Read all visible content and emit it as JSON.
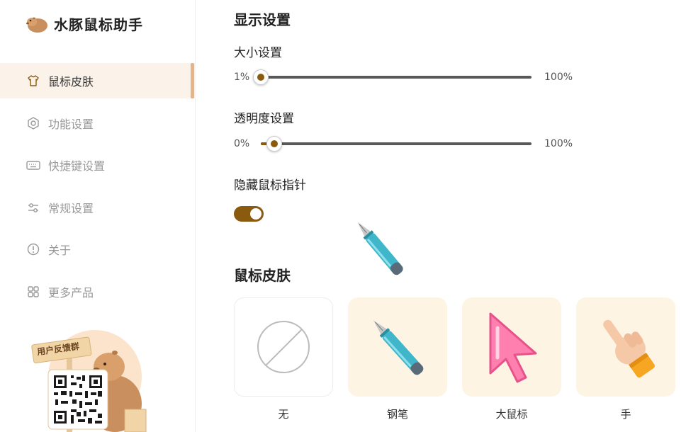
{
  "app": {
    "title": "水豚鼠标助手",
    "accent": "#8a5a0e",
    "active_bg": "#fbf3ea"
  },
  "sidebar": {
    "items": [
      {
        "label": "鼠标皮肤",
        "icon": "shirt-icon",
        "active": true
      },
      {
        "label": "功能设置",
        "icon": "hexagon-settings-icon",
        "active": false
      },
      {
        "label": "快捷键设置",
        "icon": "keyboard-icon",
        "active": false
      },
      {
        "label": "常规设置",
        "icon": "sliders-icon",
        "active": false
      },
      {
        "label": "关于",
        "icon": "info-icon",
        "active": false
      },
      {
        "label": "更多产品",
        "icon": "grid-icon",
        "active": false
      }
    ],
    "promo": {
      "sign_text": "用户反馈群",
      "image": "capybara-qr-code"
    }
  },
  "display": {
    "title": "显示设置",
    "size": {
      "label": "大小设置",
      "min_label": "1%",
      "max_label": "100%",
      "value_fraction": 0.0
    },
    "opacity": {
      "label": "透明度设置",
      "min_label": "0%",
      "max_label": "100%",
      "value_fraction": 0.05
    },
    "hide_pointer": {
      "label": "隐藏鼠标指针",
      "on": true
    }
  },
  "skins": {
    "title": "鼠标皮肤",
    "items": [
      {
        "label": "无",
        "icon": "none-icon"
      },
      {
        "label": "钢笔",
        "icon": "pen-icon"
      },
      {
        "label": "大鼠标",
        "icon": "big-cursor-icon"
      },
      {
        "label": "手",
        "icon": "hand-pointer-icon"
      }
    ]
  }
}
